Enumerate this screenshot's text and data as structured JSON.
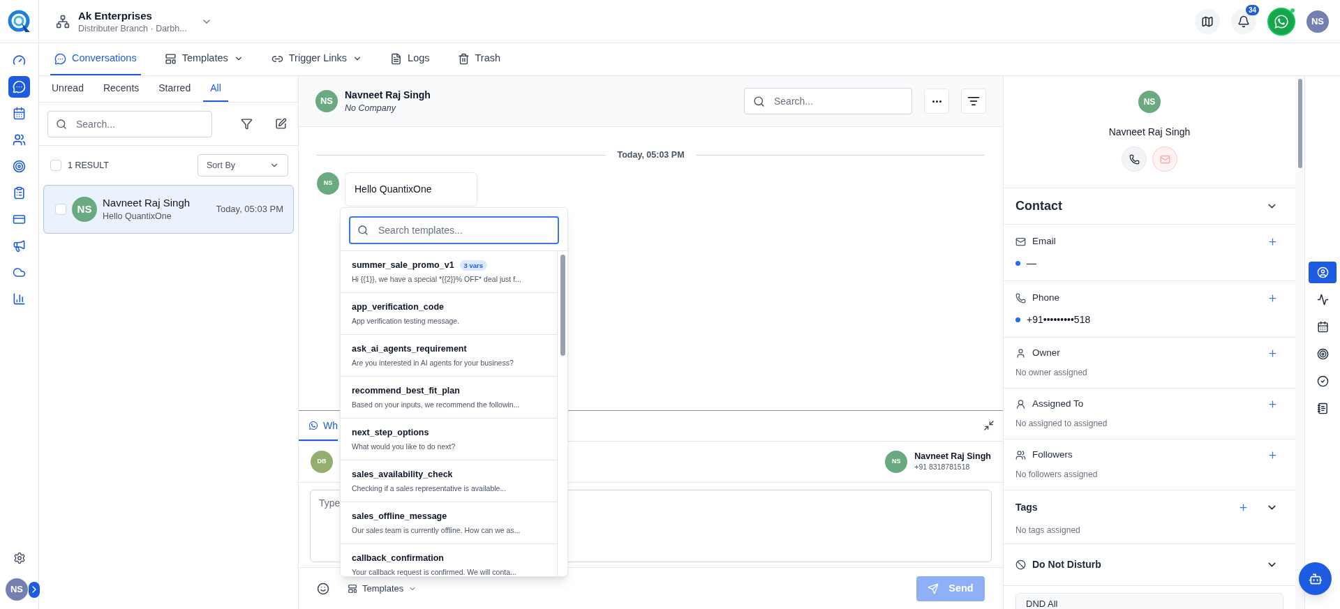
{
  "sidebar": {
    "items": [
      {
        "selected": false
      },
      {
        "selected": true
      },
      {
        "selected": false
      },
      {
        "selected": false
      },
      {
        "selected": false
      },
      {
        "selected": false
      },
      {
        "selected": false
      },
      {
        "selected": false
      },
      {
        "selected": false
      },
      {
        "selected": false
      }
    ],
    "user_initials": "NS"
  },
  "header": {
    "company": "Ak Enterprises",
    "branch": "Distributer Branch · Darbh...",
    "notification_count": "34",
    "user_initials": "NS"
  },
  "nav_tabs": [
    {
      "label": "Conversations",
      "selected": true,
      "dropdown": false
    },
    {
      "label": "Templates",
      "selected": false,
      "dropdown": true
    },
    {
      "label": "Trigger Links",
      "selected": false,
      "dropdown": true
    },
    {
      "label": "Logs",
      "selected": false,
      "dropdown": false
    },
    {
      "label": "Trash",
      "selected": false,
      "dropdown": false
    }
  ],
  "conversation_list": {
    "tabs": [
      {
        "label": "Unread",
        "selected": false
      },
      {
        "label": "Recents",
        "selected": false
      },
      {
        "label": "Starred",
        "selected": false
      },
      {
        "label": "All",
        "selected": true
      }
    ],
    "search": {
      "placeholder": "Search..."
    },
    "select_all_checked": false,
    "result_count": "1 RESULT",
    "sort": "Sort By",
    "items": [
      {
        "initials": "NS",
        "name": "Navneet Raj Singh",
        "preview": "Hello QuantixOne",
        "time": "Today, 05:03 PM",
        "selected": true,
        "checked": false
      }
    ]
  },
  "chat": {
    "contact": {
      "initials": "NS",
      "name": "Navneet Raj Singh",
      "company": "No Company"
    },
    "search": {
      "placeholder": "Search..."
    },
    "date": "Today, 05:03 PM",
    "messages": [
      {
        "initials": "NS",
        "text": "Hello QuantixOne"
      }
    ],
    "template_picker": {
      "search": {
        "placeholder": "Search templates..."
      },
      "items": [
        {
          "name": "summer_sale_promo_v1",
          "badge": "3 vars",
          "description": "Hi {{1}}, we have a special *{{2}}% OFF* deal just f..."
        },
        {
          "name": "app_verification_code",
          "description": "App verification testing message."
        },
        {
          "name": "ask_ai_agents_requirement",
          "description": "Are you interested in AI agents for your business?"
        },
        {
          "name": "recommend_best_fit_plan",
          "description": "Based on your inputs, we recommend the followin..."
        },
        {
          "name": "next_step_options",
          "description": "What would you like to do next?"
        },
        {
          "name": "sales_availability_check",
          "description": "Checking if a sales representative is available..."
        },
        {
          "name": "sales_offline_message",
          "description": "Our sales team is currently offline. How can we as..."
        },
        {
          "name": "callback_confirmation",
          "description": "Your callback request is confirmed. We will conta..."
        }
      ]
    },
    "composer": {
      "tab": "Wh",
      "sender_initials": "DB",
      "recipient": {
        "initials": "NS",
        "name": "Navneet Raj Singh",
        "phone": "+91 8318781518"
      },
      "message": {
        "placeholder": "Type"
      },
      "templates_button": "Templates",
      "send_button": {
        "label": "Send",
        "disabled": true
      }
    }
  },
  "contact_panel": {
    "initials": "NS",
    "name": "Navneet Raj Singh",
    "section_title": "Contact",
    "fields": [
      {
        "kind": "email",
        "label": "Email",
        "values": [
          "—"
        ]
      },
      {
        "kind": "phone",
        "label": "Phone",
        "values": [
          "+91•••••••••518"
        ]
      },
      {
        "kind": "owner",
        "label": "Owner",
        "empty": "No owner assigned"
      },
      {
        "kind": "assigned",
        "label": "Assigned To",
        "empty": "No assigned to assigned"
      },
      {
        "kind": "followers",
        "label": "Followers",
        "empty": "No followers assigned"
      }
    ],
    "tags": {
      "title": "Tags",
      "empty": "No tags assigned"
    },
    "dnd": {
      "title": "Do Not Disturb",
      "option": "DND All"
    }
  },
  "right_rail": {
    "items": [
      {
        "selected": true
      },
      {
        "selected": false
      },
      {
        "selected": false
      },
      {
        "selected": false
      },
      {
        "selected": false
      },
      {
        "selected": false
      }
    ]
  }
}
